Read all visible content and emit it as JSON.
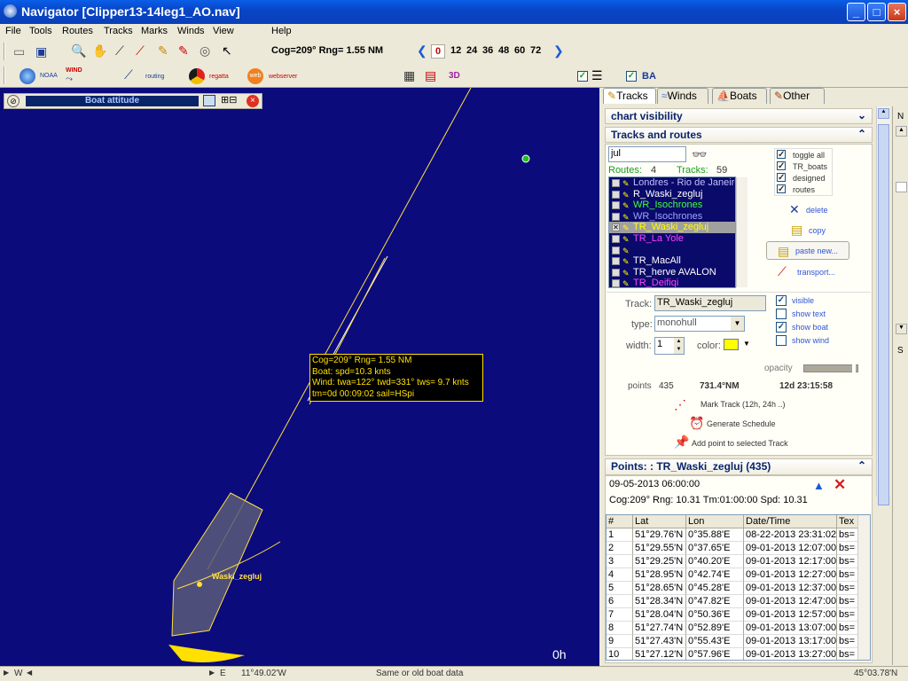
{
  "window": {
    "title": "Navigator [Clipper13-14leg1_AO.nav]"
  },
  "menu": [
    "File",
    "Tools",
    "Routes",
    "Tracks",
    "Marks",
    "Winds",
    "View",
    "Help"
  ],
  "toolbar": {
    "cog_readout": "Cog=209° Rng=  1.55 NM",
    "zoom_levels": [
      "0",
      "12",
      "24",
      "36",
      "48",
      "60",
      "72"
    ],
    "row2": {
      "noaa": "NOAA",
      "wind": "WIND",
      "routing": "routing",
      "regatta": "regatta",
      "webserver": "webserver",
      "threeD": "3D",
      "ba": "BA"
    }
  },
  "map": {
    "boat_attitude_title": "Boat attitude",
    "boat_name": "Waski_zegluj",
    "time_label": "0h",
    "tooltip": [
      "Cog=209° Rng=  1.55 NM",
      "Boat: spd=10.3 knts",
      "Wind: twa=122° twd=331° tws= 9.7 knts",
      "tm=0d 00:09:02 sail=HSpi"
    ]
  },
  "tabs": [
    "Tracks",
    "Winds",
    "Boats",
    "Other"
  ],
  "chart_visibility": {
    "title": "chart visibility"
  },
  "tracks_routes": {
    "title": "Tracks and routes",
    "search_value": "jul",
    "routes_label": "Routes:",
    "routes_count": "4",
    "tracks_label": "Tracks:",
    "tracks_count": "59",
    "items": [
      {
        "label": "Londres - Rio de Janeiro",
        "color": "#bfbfff",
        "checked": false
      },
      {
        "label": "R_Waski_zegluj",
        "color": "#ffffff",
        "checked": false
      },
      {
        "label": "WR_Isochrones",
        "color": "#40ff40",
        "checked": false
      },
      {
        "label": "WR_Isochrones",
        "color": "#a0a0ff",
        "checked": false
      },
      {
        "label": "TR_Waski_zegluj",
        "color": "#ffff00",
        "checked": true
      },
      {
        "label": "TR_La Yole",
        "color": "#ff40ff",
        "checked": false
      },
      {
        "label": "",
        "color": "#4040ff",
        "checked": false
      },
      {
        "label": "TR_MacAll",
        "color": "#ffffff",
        "checked": false
      },
      {
        "label": "TR_herve AVALON",
        "color": "#ffffff",
        "checked": false
      },
      {
        "label": "TR_Deifiqi",
        "color": "#ff40ff",
        "checked": false
      }
    ],
    "toggles": [
      "toggle all",
      "TR_boats",
      "designed",
      "routes"
    ],
    "actions": {
      "delete": "delete",
      "copy": "copy",
      "paste": "paste new...",
      "transport": "transport..."
    },
    "track_label": "Track:",
    "track_name": "TR_Waski_zegluj",
    "type_label": "type:",
    "type_value": "monohull",
    "width_label": "width:",
    "width_value": "1",
    "color_label": "color:",
    "color_value": "#ffff00",
    "options": [
      {
        "label": "visible",
        "checked": true
      },
      {
        "label": "show text",
        "checked": false
      },
      {
        "label": "show boat",
        "checked": true
      },
      {
        "label": "show wind",
        "checked": false
      }
    ],
    "opacity_label": "opacity",
    "points_label": "points",
    "points_count": "435",
    "distance": "731.4°NM",
    "duration": "12d 23:15:58",
    "mark_track": "Mark Track (12h, 24h ..)",
    "generate_schedule": "Generate Schedule",
    "add_point": "Add point to selected Track"
  },
  "points": {
    "title": "Points: : TR_Waski_zegluj (435)",
    "datetime": "09-05-2013 06:00:00",
    "summary": "Cog:209° Rng: 10.31 Tm:01:00:00 Spd: 10.31",
    "headers": [
      "#",
      "Lat",
      "Lon",
      "Date/Time",
      "Tex"
    ],
    "rows": [
      [
        "1",
        "51°29.76'N",
        "0°35.88'E",
        "08-22-2013 23:31:02",
        "bs="
      ],
      [
        "2",
        "51°29.55'N",
        "0°37.65'E",
        "09-01-2013 12:07:00",
        "bs="
      ],
      [
        "3",
        "51°29.25'N",
        "0°40.20'E",
        "09-01-2013 12:17:00",
        "bs="
      ],
      [
        "4",
        "51°28.95'N",
        "0°42.74'E",
        "09-01-2013 12:27:00",
        "bs="
      ],
      [
        "5",
        "51°28.65'N",
        "0°45.28'E",
        "09-01-2013 12:37:00",
        "bs="
      ],
      [
        "6",
        "51°28.34'N",
        "0°47.82'E",
        "09-01-2013 12:47:00",
        "bs="
      ],
      [
        "7",
        "51°28.04'N",
        "0°50.36'E",
        "09-01-2013 12:57:00",
        "bs="
      ],
      [
        "8",
        "51°27.74'N",
        "0°52.89'E",
        "09-01-2013 13:07:00",
        "bs="
      ],
      [
        "9",
        "51°27.43'N",
        "0°55.43'E",
        "09-01-2013 13:17:00",
        "bs="
      ],
      [
        "10",
        "51°27.12'N",
        "0°57.96'E",
        "09-01-2013 13:27:00",
        "bs="
      ]
    ]
  },
  "right_strip": {
    "n": "N",
    "s": "S"
  },
  "status": {
    "w": "W",
    "e": "E",
    "lon": "11°49.02'W",
    "msg": "Same or old boat data",
    "lat": "45°03.78'N"
  }
}
